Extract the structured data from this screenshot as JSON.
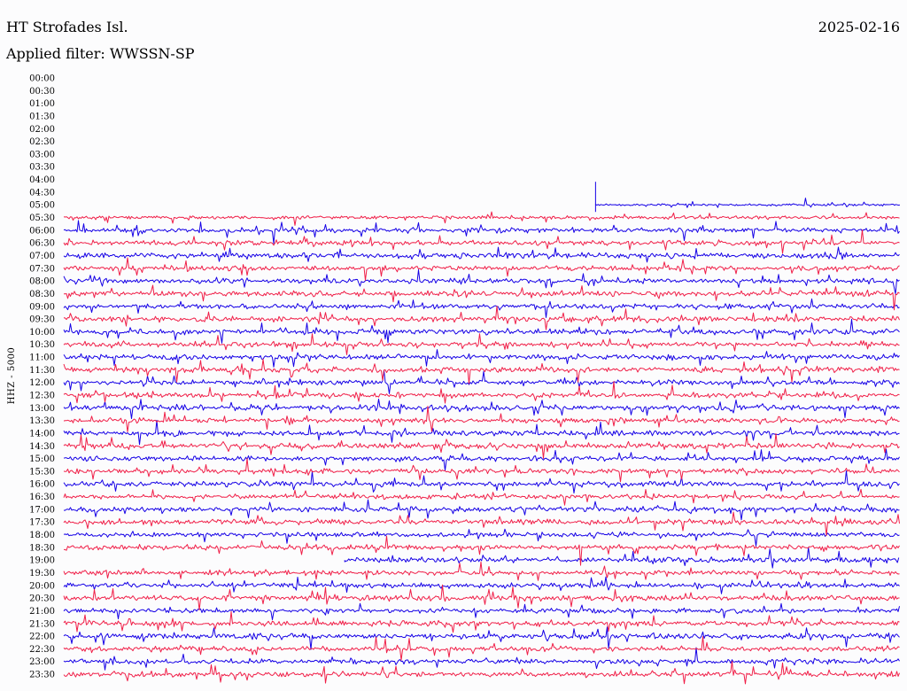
{
  "header": {
    "station": "HT Strofades Isl.",
    "date": "2025-02-16",
    "filter_text": "Applied filter: WWSSN-SP"
  },
  "colors": {
    "background": "#fcfcfd",
    "trace_blue": "#1500e6",
    "trace_red": "#f01f48",
    "text": "#000000"
  },
  "chart_data": {
    "type": "line",
    "title": "HT Strofades Isl.",
    "subtitle": "Applied filter: WWSSN-SP",
    "date": "2025-02-16",
    "xlabel": "",
    "ylabel": "HHZ - 5000",
    "y_tick_labels": [
      "00:00",
      "00:30",
      "01:00",
      "01:30",
      "02:00",
      "02:30",
      "03:00",
      "03:30",
      "04:00",
      "04:30",
      "05:00",
      "05:30",
      "06:00",
      "06:30",
      "07:00",
      "07:30",
      "08:00",
      "08:30",
      "09:00",
      "09:30",
      "10:00",
      "10:30",
      "11:00",
      "11:30",
      "12:00",
      "12:30",
      "13:00",
      "13:30",
      "14:00",
      "14:30",
      "15:00",
      "15:30",
      "16:00",
      "16:30",
      "17:00",
      "17:30",
      "18:00",
      "18:30",
      "19:00",
      "19:30",
      "20:00",
      "20:30",
      "21:00",
      "21:30",
      "22:00",
      "22:30",
      "23:00",
      "23:30"
    ],
    "series": [
      {
        "color": "#1500e6",
        "rows": [
          "05:00",
          "06:00",
          "07:00",
          "08:00",
          "09:00",
          "10:00",
          "11:00",
          "12:00",
          "13:00",
          "14:00",
          "15:00",
          "16:00",
          "17:00",
          "18:00",
          "19:00",
          "20:00",
          "21:00",
          "22:00",
          "23:00"
        ]
      },
      {
        "color": "#f01f48",
        "rows": [
          "05:30",
          "06:30",
          "07:30",
          "08:30",
          "09:30",
          "10:30",
          "11:30",
          "12:30",
          "13:30",
          "14:30",
          "15:30",
          "16:30",
          "17:30",
          "18:30",
          "19:30",
          "20:30",
          "21:30",
          "22:30",
          "23:30"
        ]
      }
    ],
    "partial_rows": [
      {
        "row": "05:00",
        "start_fraction": 0.636
      },
      {
        "row": "19:00",
        "start_fraction": 0.336
      }
    ],
    "grid": false,
    "legend": false
  }
}
